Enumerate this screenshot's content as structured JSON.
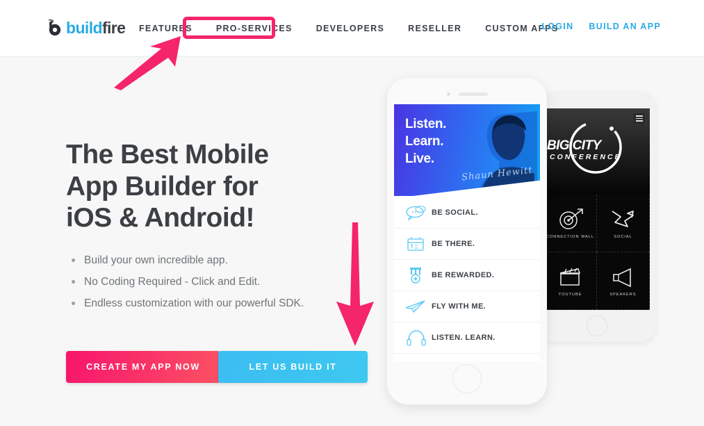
{
  "header": {
    "logo": {
      "icon": "buildfire-flame-logo",
      "part1": "build",
      "part2": "fire"
    },
    "nav": [
      {
        "label": "FEATURES",
        "highlighted": false
      },
      {
        "label": "PRO-SERVICES",
        "highlighted": true
      },
      {
        "label": "DEVELOPERS",
        "highlighted": false
      },
      {
        "label": "RESELLER",
        "highlighted": false
      },
      {
        "label": "CUSTOM APPS",
        "highlighted": false
      }
    ],
    "nav_right": [
      {
        "label": "LOGIN"
      },
      {
        "label": "BUILD AN APP"
      }
    ]
  },
  "hero": {
    "headline_lines": [
      "The Best Mobile",
      "App Builder for",
      "iOS & Android!"
    ],
    "bullets": [
      "Build your own incredible app.",
      "No Coding Required - Click and Edit.",
      "Endless customization with our powerful SDK."
    ],
    "cta_primary": "CREATE MY APP NOW",
    "cta_secondary": "LET US BUILD IT"
  },
  "annotations": {
    "arrow_to_nav": "arrow-pointing-to-pro-services",
    "arrow_to_button": "arrow-pointing-to-let-us-build-it",
    "highlight_box": "pro-services-highlight-box"
  },
  "phone_front": {
    "hero_lines": [
      "Listen.",
      "Learn.",
      "Live."
    ],
    "signature": "Shaun Hewitt",
    "menu": [
      {
        "label": "BE SOCIAL.",
        "icon": "chat-bubbles-icon"
      },
      {
        "label": "BE THERE.",
        "icon": "calendar-ticket-icon"
      },
      {
        "label": "BE REWARDED.",
        "icon": "medal-icon"
      },
      {
        "label": "FLY WITH ME.",
        "icon": "paper-plane-icon"
      },
      {
        "label": "LISTEN. LEARN.",
        "icon": "headphones-icon"
      }
    ]
  },
  "phone_back": {
    "title": "BIG CITY",
    "subtitle": "CONFERENCE",
    "tiles": [
      {
        "label": "CONNECTION WALL",
        "icon": "target-arrow-icon"
      },
      {
        "label": "SOCIAL",
        "icon": "zigzag-arrow-icon"
      },
      {
        "label": "YOUTUBE",
        "icon": "clapperboard-icon"
      },
      {
        "label": "SPEAKERS",
        "icon": "megaphone-icon"
      },
      {
        "label": "",
        "icon": "checkbox-icon"
      },
      {
        "label": "",
        "icon": "compass-icon"
      }
    ]
  },
  "colors": {
    "accent_pink": "#f5256b",
    "accent_blue": "#29abe2",
    "text_dark": "#3c3f43",
    "text_muted": "#6f7478",
    "page_bg": "#f7f7f7"
  }
}
